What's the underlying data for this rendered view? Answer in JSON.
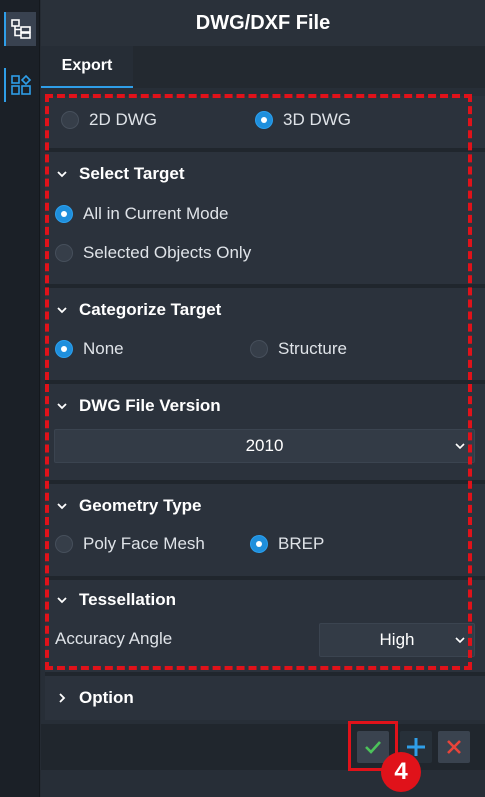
{
  "panel": {
    "title": "DWG/DXF File"
  },
  "tabs": [
    {
      "label": "Export"
    }
  ],
  "export_type": {
    "options": [
      "2D DWG",
      "3D DWG"
    ],
    "selected": "3D DWG"
  },
  "select_target": {
    "heading": "Select Target",
    "options": [
      "All in Current Mode",
      "Selected Objects Only"
    ],
    "selected": "All in Current Mode"
  },
  "categorize_target": {
    "heading": "Categorize Target",
    "options": [
      "None",
      "Structure"
    ],
    "selected": "None"
  },
  "dwg_version": {
    "heading": "DWG File Version",
    "value": "2010"
  },
  "geometry_type": {
    "heading": "Geometry Type",
    "options": [
      "Poly Face Mesh",
      "BREP"
    ],
    "selected": "BREP"
  },
  "tessellation": {
    "heading": "Tessellation",
    "accuracy_label": "Accuracy Angle",
    "accuracy_value": "High"
  },
  "option": {
    "heading": "Option"
  },
  "annotation": {
    "step_number": "4"
  },
  "colors": {
    "accent": "#1f8fdc",
    "highlight": "#e0121a",
    "ok": "#4cc35a",
    "add": "#2f9ee8",
    "cancel": "#e8443a"
  },
  "icons": {
    "rail_1": "tree-view-icon",
    "rail_2": "layout-icon",
    "ok": "checkmark-icon",
    "add": "plus-icon",
    "cancel": "close-icon"
  }
}
